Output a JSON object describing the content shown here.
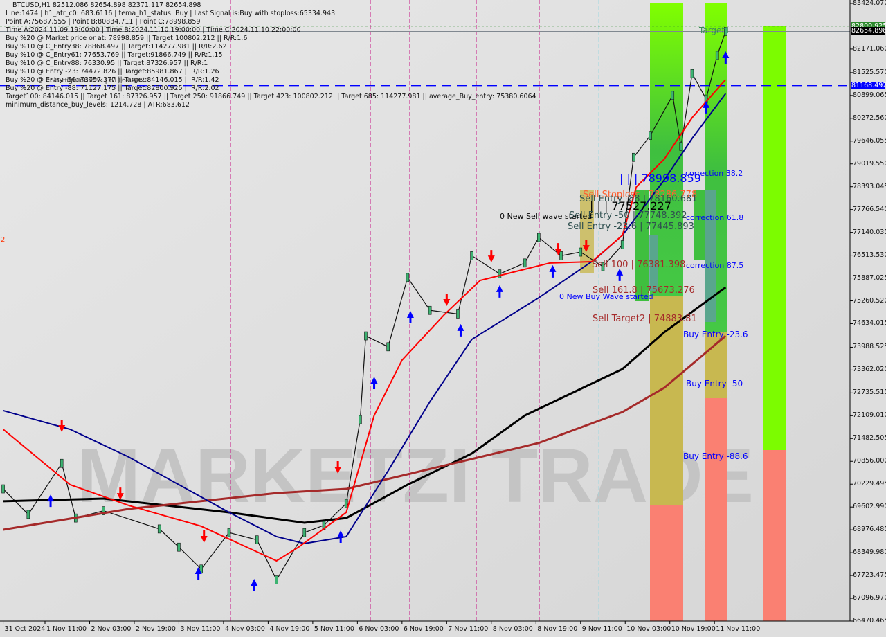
{
  "header": {
    "symbol_line": "BTCUSD,H1  82512.086 82654.898 82371.117 82654.898",
    "lines": [
      "Line:1474 | h1_atr_c0: 683.6116 | tema_h1_status: Buy | Last Signal is:Buy with stoploss:65334.943",
      "Point A:75687.555 | Point B:80834.711 | Point C:78998.859",
      "Time A:2024.11.09 19:00:00 | Time B:2024.11.10 19:00:00 | Time C:2024.11.10 22:00:00",
      "Buy %20 @ Market price or at: 78998.859 || Target:100802.212 || R/R:1.6",
      "Buy %10 @ C_Entry38: 78868.497 || Target:114277.981 || R/R:2.62",
      "Buy %10 @ C_Entry61: 77653.769 || Target:91866.749 || R/R:1.15",
      "Buy %10 @ C_Entry88: 76330.95 || Target:87326.957 || R/R:1",
      "Buy %10 @ Entry -23: 74472.826 || Target:85981.867 || R/R:1.26",
      "Buy %20 @ Entry -50: 73757.377 || Target:84146.015 || R/R:1.42",
      "Buy %20 @ Entry -88: 71127.175 || Target:82800.925 || R/R:2.02",
      "Target100: 84146.015 || Target 161: 87326.957 || Target 250: 91866.749 || Target 423: 100802.212 || Target 685: 114277.981 || average_Buy_entry: 75380.6064",
      "minimum_distance_buy_levels: 1214.728 | ATR:683.612"
    ],
    "fsb_label": "FSB-HighToBreak | 81168.492"
  },
  "watermark": "MARKETZI TRADE",
  "chart_data": {
    "type": "line",
    "title": "BTCUSD,H1",
    "ylim": [
      66470.465,
      83424.07
    ],
    "y_ticks": [
      "83424.070",
      "82171.060",
      "81525.570",
      "80899.065",
      "80272.560",
      "79646.055",
      "79019.550",
      "78393.045",
      "77766.540",
      "77140.035",
      "76513.530",
      "75887.025",
      "75260.520",
      "74634.015",
      "73988.525",
      "73362.020",
      "72735.515",
      "72109.010",
      "71482.505",
      "70856.000",
      "70229.495",
      "69602.990",
      "68976.485",
      "68349.980",
      "67723.475",
      "67096.970",
      "66470.465"
    ],
    "x_ticks": [
      "31 Oct 2024",
      "1 Nov 11:00",
      "2 Nov 03:00",
      "2 Nov 19:00",
      "3 Nov 11:00",
      "4 Nov 03:00",
      "4 Nov 19:00",
      "5 Nov 11:00",
      "6 Nov 03:00",
      "6 Nov 19:00",
      "7 Nov 11:00",
      "8 Nov 03:00",
      "8 Nov 19:00",
      "9 Nov 11:00",
      "10 Nov 03:00",
      "10 Nov 19:00",
      "11 Nov 11:00"
    ],
    "x_tick_times": [
      "2024-10-31 20:00",
      "2024-11-01 11:00",
      "2024-11-02 03:00",
      "2024-11-02 19:00",
      "2024-11-03 11:00",
      "2024-11-04 03:00",
      "2024-11-04 19:00",
      "2024-11-05 11:00",
      "2024-11-06 03:00",
      "2024-11-06 19:00",
      "2024-11-07 11:00",
      "2024-11-08 03:00",
      "2024-11-08 19:00",
      "2024-11-09 11:00",
      "2024-11-10 03:00",
      "2024-11-10 19:00",
      "2024-11-11 11:00"
    ],
    "price": [
      [
        "2024-10-31 20:00",
        70100
      ],
      [
        "2024-11-01 05:00",
        69400
      ],
      [
        "2024-11-01 17:00",
        70800
      ],
      [
        "2024-11-01 22:00",
        69300
      ],
      [
        "2024-11-02 08:00",
        69500
      ],
      [
        "2024-11-03 04:00",
        69000
      ],
      [
        "2024-11-03 11:00",
        68500
      ],
      [
        "2024-11-03 19:00",
        67900
      ],
      [
        "2024-11-04 05:00",
        68900
      ],
      [
        "2024-11-04 15:00",
        68700
      ],
      [
        "2024-11-04 22:00",
        67600
      ],
      [
        "2024-11-05 08:00",
        68900
      ],
      [
        "2024-11-05 15:00",
        69100
      ],
      [
        "2024-11-05 23:00",
        69700
      ],
      [
        "2024-11-06 04:00",
        72000
      ],
      [
        "2024-11-06 06:00",
        74300
      ],
      [
        "2024-11-06 14:00",
        74000
      ],
      [
        "2024-11-06 21:00",
        75900
      ],
      [
        "2024-11-07 05:00",
        75000
      ],
      [
        "2024-11-07 15:00",
        74900
      ],
      [
        "2024-11-07 20:00",
        76500
      ],
      [
        "2024-11-08 06:00",
        76000
      ],
      [
        "2024-11-08 15:00",
        76300
      ],
      [
        "2024-11-08 20:00",
        77000
      ],
      [
        "2024-11-09 04:00",
        76500
      ],
      [
        "2024-11-09 11:00",
        76600
      ],
      [
        "2024-11-09 19:00",
        76200
      ],
      [
        "2024-11-10 02:00",
        76800
      ],
      [
        "2024-11-10 06:00",
        79200
      ],
      [
        "2024-11-10 12:00",
        79800
      ],
      [
        "2024-11-10 20:00",
        80900
      ],
      [
        "2024-11-10 23:00",
        79500
      ],
      [
        "2024-11-11 03:00",
        81500
      ],
      [
        "2024-11-11 08:00",
        80800
      ],
      [
        "2024-11-11 12:00",
        82000
      ],
      [
        "2024-11-11 15:00",
        82654.898
      ]
    ],
    "series": [
      {
        "color": "#000000",
        "points": [
          [
            "2024-10-31 20:00",
            69760
          ],
          [
            "2024-11-02 08:00",
            69835
          ],
          [
            "2024-11-04 05:00",
            69455
          ],
          [
            "2024-11-05 08:00",
            69170
          ],
          [
            "2024-11-05 23:00",
            69300
          ],
          [
            "2024-11-06 21:00",
            70215
          ],
          [
            "2024-11-07 20:00",
            71070
          ],
          [
            "2024-11-08 15:00",
            72115
          ],
          [
            "2024-11-10 02:00",
            73390
          ],
          [
            "2024-11-10 17:00",
            74400
          ],
          [
            "2024-11-11 15:00",
            75630
          ]
        ]
      },
      {
        "color": "#a52a2a",
        "points": [
          [
            "2024-10-31 20:00",
            68980
          ],
          [
            "2024-11-02 17:00",
            69550
          ],
          [
            "2024-11-04 22:00",
            69985
          ],
          [
            "2024-11-05 23:00",
            70100
          ],
          [
            "2024-11-06 21:00",
            70500
          ],
          [
            "2024-11-07 20:00",
            70920
          ],
          [
            "2024-11-08 20:00",
            71360
          ],
          [
            "2024-11-10 02:00",
            72210
          ],
          [
            "2024-11-10 17:00",
            72875
          ],
          [
            "2024-11-11 15:00",
            74300
          ]
        ]
      },
      {
        "color": "#00008b",
        "points": [
          [
            "2024-10-31 20:00",
            72250
          ],
          [
            "2024-11-01 20:00",
            71735
          ],
          [
            "2024-11-02 17:00",
            70975
          ],
          [
            "2024-11-04 05:00",
            69455
          ],
          [
            "2024-11-04 22:00",
            68790
          ],
          [
            "2024-11-05 08:00",
            68600
          ],
          [
            "2024-11-05 23:00",
            68790
          ],
          [
            "2024-11-06 14:00",
            70595
          ],
          [
            "2024-11-07 05:00",
            72495
          ],
          [
            "2024-11-07 20:00",
            74205
          ],
          [
            "2024-11-08 20:00",
            75345
          ],
          [
            "2024-11-09 16:00",
            76390
          ],
          [
            "2024-11-10 02:00",
            77060
          ],
          [
            "2024-11-10 17:00",
            78580
          ],
          [
            "2024-11-11 03:00",
            79720
          ],
          [
            "2024-11-11 15:00",
            80950
          ]
        ]
      },
      {
        "color": "#ff0000",
        "points": [
          [
            "2024-10-31 20:00",
            71735
          ],
          [
            "2024-11-01 08:00",
            70975
          ],
          [
            "2024-11-01 20:00",
            70215
          ],
          [
            "2024-11-02 17:00",
            69645
          ],
          [
            "2024-11-03 19:00",
            69075
          ],
          [
            "2024-11-04 22:00",
            68125
          ],
          [
            "2024-11-05 06:00",
            68505
          ],
          [
            "2024-11-05 23:00",
            69455
          ],
          [
            "2024-11-06 09:00",
            72115
          ],
          [
            "2024-11-06 19:00",
            73635
          ],
          [
            "2024-11-07 10:00",
            74870
          ],
          [
            "2024-11-07 23:00",
            75820
          ],
          [
            "2024-11-09 00:00",
            76300
          ],
          [
            "2024-11-09 15:00",
            76335
          ],
          [
            "2024-11-10 02:00",
            77060
          ],
          [
            "2024-11-10 07:00",
            78390
          ],
          [
            "2024-11-10 17:00",
            79150
          ],
          [
            "2024-11-11 03:00",
            80290
          ],
          [
            "2024-11-11 15:00",
            81335
          ]
        ]
      }
    ],
    "sell_signals": [
      [
        "2024-11-01 17:00",
        71735
      ],
      [
        "2024-11-02 14:00",
        69870
      ],
      [
        "2024-11-03 20:00",
        68695
      ],
      [
        "2024-11-05 20:00",
        70595
      ],
      [
        "2024-11-07 11:00",
        75195
      ],
      [
        "2024-11-08 03:00",
        76390
      ],
      [
        "2024-11-09 03:00",
        76580
      ],
      [
        "2024-11-09 13:00",
        76675
      ]
    ],
    "buy_signals": [
      [
        "2024-11-01 13:00",
        69870
      ],
      [
        "2024-11-03 18:00",
        67877
      ],
      [
        "2024-11-04 14:00",
        67555
      ],
      [
        "2024-11-05 21:00",
        68885
      ],
      [
        "2024-11-06 09:00",
        73104
      ],
      [
        "2024-11-06 22:00",
        74910
      ],
      [
        "2024-11-07 16:00",
        74550
      ],
      [
        "2024-11-08 06:00",
        75615
      ],
      [
        "2024-11-09 01:00",
        76165
      ],
      [
        "2024-11-10 01:00",
        76070
      ],
      [
        "2024-11-11 08:00",
        80670
      ],
      [
        "2024-11-11 15:00",
        82036
      ]
    ],
    "hlines": [
      {
        "price": 82800.925,
        "color": "#2e8b2e",
        "style": "dotted",
        "label": "82800.925"
      },
      {
        "price": 82654.898,
        "color": "#000000",
        "style": "solid",
        "label": "82654.898"
      },
      {
        "price": 81168.492,
        "color": "#0000ff",
        "style": "dashed",
        "label": "81168.492"
      }
    ],
    "annotations": {
      "target1": "Target1",
      "corr382": "correction 38.2",
      "corr618": "correction 61.8",
      "corr875": "correction 87.5",
      "buy236": "Buy Entry -23.6",
      "buy50": "Buy Entry -50",
      "buy886": "Buy Entry -88.6",
      "pointc": "| | | 78998.859",
      "sell_sl": "Sell Stoploss | 78286.778",
      "sell886": "Sell Entry -88 | 78160.681",
      "pointx": "| | | 77527.227",
      "sell50": "Sell Entry -50 | 77748.392",
      "sell236": "Sell Entry -23.6 | 77445.893",
      "new_sell": "0 New Sell wave started",
      "sell100": "Sell 100 | 76381.398",
      "sell1618": "Sell 161.8 | 75673.276",
      "new_buy": "0 New Buy Wave started",
      "sell_t2": "Sell Target2 | 74883.81",
      "left_mark": "2"
    },
    "colors": {
      "zone_green": "#7cfc00",
      "zone_tan": "#c8b850",
      "zone_salmon": "#fa8072",
      "candle_up": "#3cb371",
      "candle_down": "#b22222"
    }
  }
}
